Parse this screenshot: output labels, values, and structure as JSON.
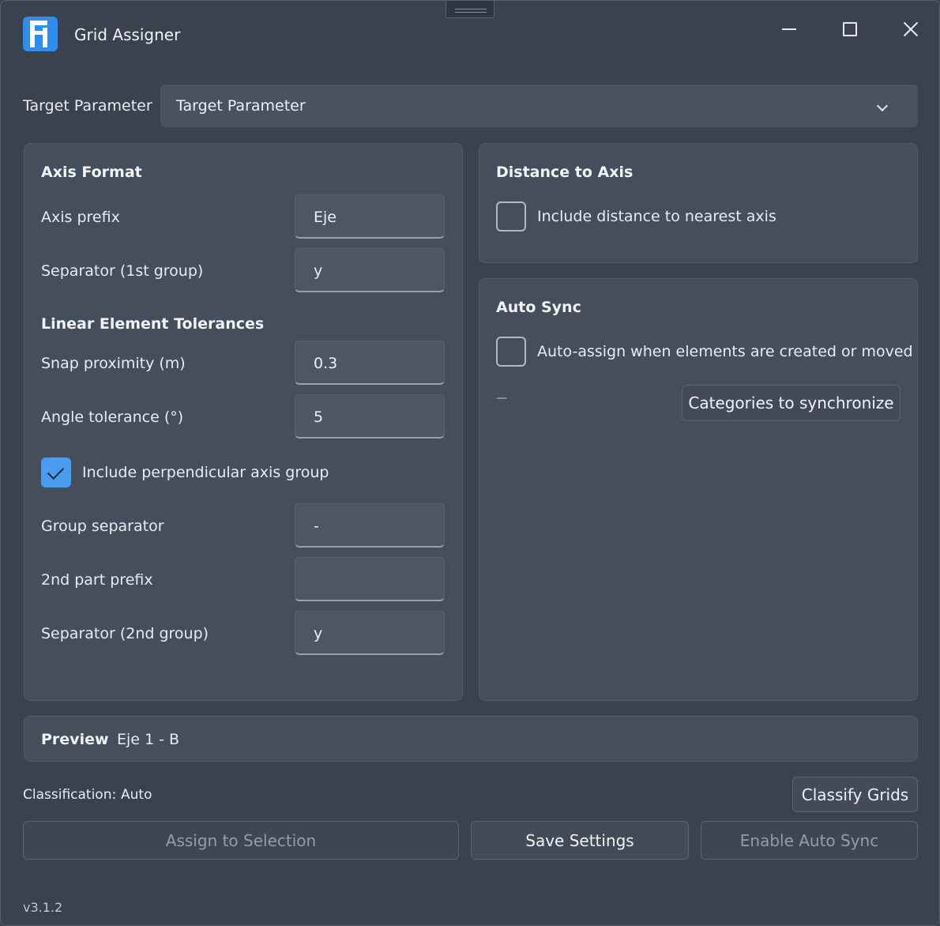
{
  "window": {
    "title": "Grid Assigner",
    "controls": [
      "minimize",
      "maximize",
      "close"
    ]
  },
  "target_parameter": {
    "label": "Target Parameter",
    "selected": "Target Parameter"
  },
  "axis_format": {
    "title": "Axis Format",
    "axis_prefix": {
      "label": "Axis prefix",
      "value": "Eje"
    },
    "separator_first": {
      "label": "Separator (1st group)",
      "value": "y"
    },
    "tolerances_title": "Linear Element Tolerances",
    "snap_proximity": {
      "label": "Snap proximity (m)",
      "value": "0.3"
    },
    "angle_tolerance": {
      "label": "Angle tolerance (°)",
      "value": "5"
    },
    "include_perpendicular": {
      "label": "Include perpendicular axis group",
      "checked": true
    },
    "group_separator": {
      "label": "Group separator",
      "value": "-"
    },
    "second_prefix": {
      "label": "2nd part prefix",
      "value": ""
    },
    "separator_second": {
      "label": "Separator (2nd group)",
      "value": "y"
    }
  },
  "distance_to_axis": {
    "title": "Distance to Axis",
    "include_distance": {
      "label": "Include distance to nearest axis",
      "checked": false
    }
  },
  "auto_sync": {
    "title": "Auto Sync",
    "auto_assign": {
      "label": "Auto-assign when elements are created or moved",
      "checked": false
    },
    "categories_count": "—",
    "categories_button": "Categories to synchronize"
  },
  "preview": {
    "label": "Preview",
    "value": "Eje 1 - B"
  },
  "classification": {
    "label": "Classification:",
    "value": "Auto",
    "classify_button": "Classify Grids"
  },
  "actions": {
    "assign_button": "Assign to Selection",
    "save_button": "Save Settings",
    "enable_sync_button": "Enable Auto Sync"
  },
  "version": "v3.1.2",
  "colors": {
    "background": "#3a4250",
    "card": "#454e5c",
    "accent": "#4a9cf0",
    "app_icon": "#2e8ef0"
  }
}
